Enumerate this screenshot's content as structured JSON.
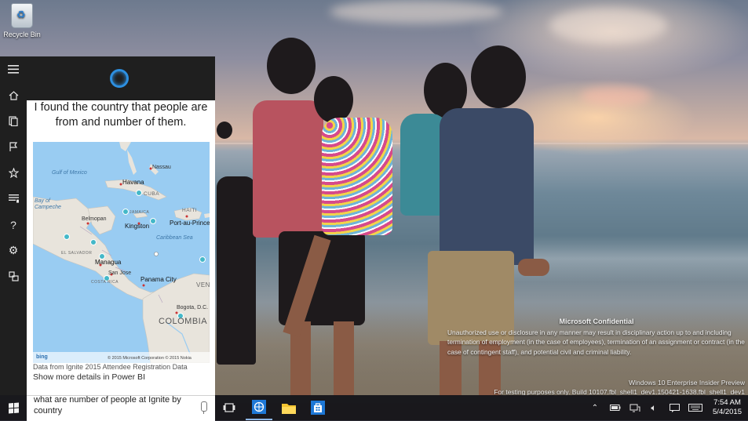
{
  "desktop": {
    "recycle_bin_label": "Recycle Bin"
  },
  "watermark": {
    "heading": "Microsoft Confidential",
    "body": "Unauthorized use or disclosure in any manner may result in disciplinary action up to and including termination of employment (in the case of employees), termination of an assignment or contract (in the case of contingent staff), and potential civil and criminal liability.",
    "edition": "Windows 10 Enterprise Insider Preview",
    "build": "For testing purposes only. Build 10107.fbl_shell1_dev1.150421-1638.fbl_shell1_dev1"
  },
  "cortana": {
    "rail_icons": [
      "hamburger-icon",
      "home-icon",
      "notebook-icon",
      "reminders-icon",
      "favorites-icon",
      "feedback-list-icon",
      "help-icon",
      "settings-icon",
      "devices-icon"
    ],
    "answer_title": "I found the country that people are from and number of them.",
    "map": {
      "labels": {
        "gulf_of_mexico": "Gulf of Mexico",
        "nassau": "Nassau",
        "havana": "Havana",
        "cuba": "CUBA",
        "bay_of_campeche": "Bay of Campeche",
        "belmopan": "Belmopan",
        "jamaica": "JAMAICA",
        "kingston": "Kingston",
        "haiti": "HAITI",
        "port_au_prince": "Port-au-Prince",
        "caribbean_sea": "Caribbean Sea",
        "el_salvador": "EL SALVADOR",
        "managua": "Managua",
        "san_jose": "San Jose",
        "costa_rica": "COSTA RICA",
        "panama_city": "Panama City",
        "bogota": "Bogota, D.C.",
        "colombia": "COLOMBIA",
        "venezuela": "VENE"
      },
      "footer_logo": "bing",
      "footer_copyright": "© 2015 Microsoft Corporation   © 2015 Nokia"
    },
    "data_source": "Data from Ignite 2015 Attendee Registration Data",
    "more_link": "Show more details in Power BI",
    "search_query": "what are number of people at Ignite by country"
  },
  "taskbar": {
    "apps": [
      "task-view-icon",
      "internet-explorer-icon",
      "file-explorer-icon",
      "store-icon"
    ],
    "time": "7:54 AM",
    "date": "5/4/2015"
  },
  "colors": {
    "cortana_blue": "#2d8fe0",
    "panel_dark": "#1f1f1f",
    "taskbar": "#121218"
  }
}
